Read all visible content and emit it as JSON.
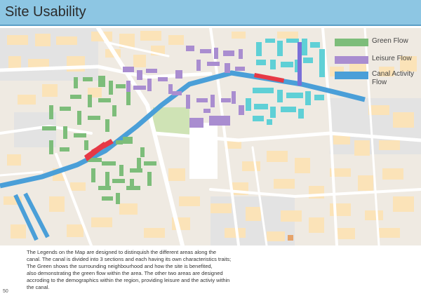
{
  "header": {
    "title": "Site Usability"
  },
  "legend": [
    {
      "label": "Green Flow",
      "color": "#7dbd7a"
    },
    {
      "label": "Leisure Flow",
      "color": "#a98dd0"
    },
    {
      "label": "Canal Activity Flow",
      "color": "#4a9fd8"
    }
  ],
  "description": {
    "lines": [
      "The Legends on the Map are designed to distinquish the different areas along the",
      "canal. The canal is divided into 3 sections and each having its own characteristics traits;",
      "The Green shows the surrounding neighbourhood and how the site is benefited,",
      "also demonstrating the green flow within the area. The other two areas are designed",
      "accroding to the demographics within the region, providing leisure and the activiy within",
      "the canal."
    ]
  },
  "page": {
    "number": "50"
  },
  "map_colors": {
    "water": "#4a9fd8",
    "building": "#fbe3b8",
    "road": "#ffffff",
    "landuse_gray": "#e2e2e2",
    "park": "#cde3b4",
    "highlight": "#e63946",
    "leisure": "#a98dd0",
    "canal_zone": "#5fd0d6",
    "green": "#7dbd7a"
  }
}
